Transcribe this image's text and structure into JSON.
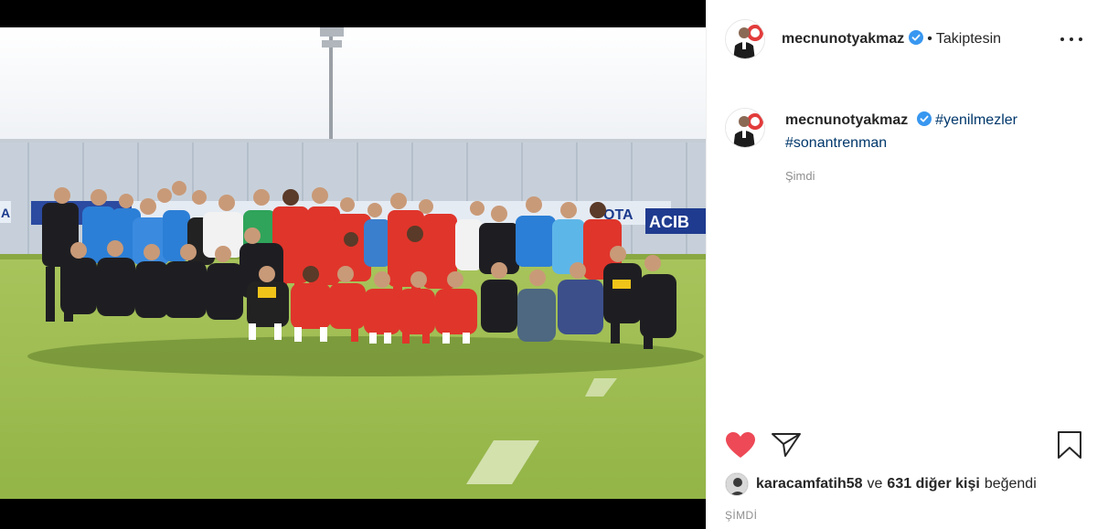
{
  "post": {
    "username": "mecnunotyakmaz",
    "follow_dot": "•",
    "follow_status": "Takiptesin",
    "caption_tags": [
      "#yenilmezler",
      "#sonantrenman"
    ],
    "caption_time": "Şimdi",
    "liked_by": "karacamfatih58",
    "likes_joiner": "ve",
    "likes_others": "631 diğer kişi",
    "likes_suffix": "beğendi",
    "post_time": "ŞİMDİ"
  },
  "photo": {
    "banner_text": "ACIB",
    "banner_text_2": "ΟΤΑ",
    "banner_text_3": "A"
  },
  "colors": {
    "heart": "#ed4956",
    "verified": "#3897f0",
    "hashtag": "#00376b"
  },
  "icons": {
    "like": "heart-icon",
    "share": "paper-plane-icon",
    "save": "bookmark-icon",
    "more": "more-options-icon",
    "verified": "verified-badge-icon"
  }
}
